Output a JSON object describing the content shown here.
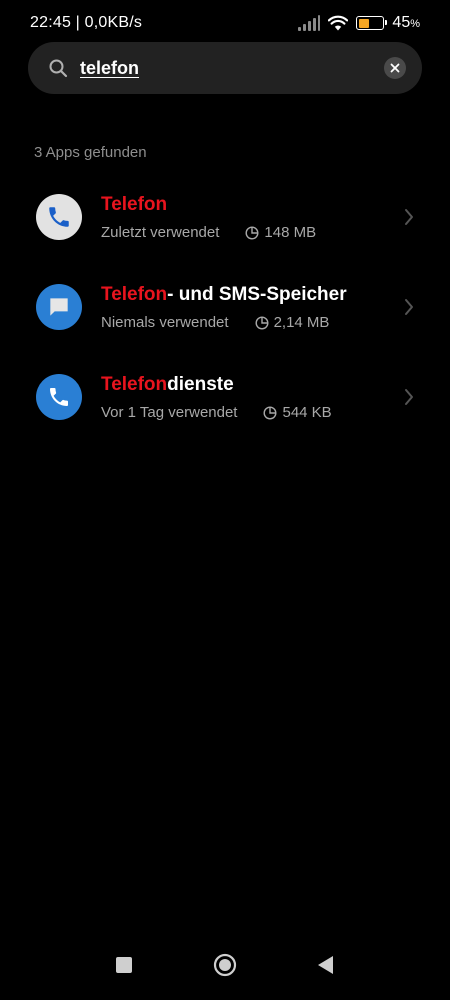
{
  "status_bar": {
    "time_and_speed": "22:45 | 0,0KB/s",
    "battery_percent": "45",
    "battery_symbol": "%",
    "battery_level": 0.45
  },
  "search": {
    "query": "telefon",
    "placeholder": ""
  },
  "results": {
    "count_label": "3 Apps gefunden",
    "items": [
      {
        "title_highlight": "Telefon",
        "title_rest": "",
        "last_used": "Zuletzt verwendet",
        "size": "148 MB",
        "icon": "phone-app-icon"
      },
      {
        "title_highlight": "Telefon",
        "title_rest": "- und SMS-Speicher",
        "last_used": "Niemals verwendet",
        "size": "2,14 MB",
        "icon": "message-app-icon"
      },
      {
        "title_highlight": "Telefon",
        "title_rest": "dienste",
        "last_used": "Vor 1 Tag verwendet",
        "size": "544 KB",
        "icon": "phone-services-icon"
      }
    ]
  },
  "colors": {
    "background": "#000000",
    "search_bg": "#222222",
    "highlight": "#e8141e",
    "icon_blue": "#2a7fd4",
    "battery": "#f5a623"
  },
  "nav_bar": {
    "buttons": [
      "recents-icon",
      "home-icon",
      "back-icon"
    ]
  }
}
